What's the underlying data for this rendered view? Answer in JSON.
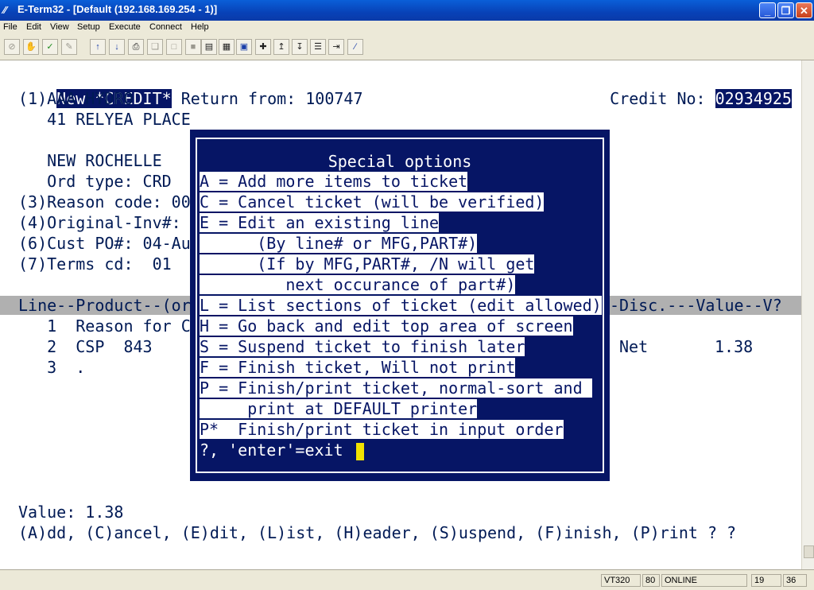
{
  "window": {
    "title": "E-Term32 - [Default (192.168.169.254 - 1)]"
  },
  "menu": [
    "File",
    "Edit",
    "View",
    "Setup",
    "Execute",
    "Connect",
    "Help"
  ],
  "terminal": {
    "credit_hl": "New *CREDIT*",
    "return_from": " Return from: 100747",
    "credit_no_label": "Credit No: ",
    "credit_no": "02934925",
    "customer": "(1)AAA HYDRO",
    "address1": "   41 RELYEA PLACE",
    "city": "   NEW ROCHELLE",
    "ord_type": "   Ord type: CRD",
    "reason_code": "(3)Reason code: 00",
    "orig_inv": "(4)Original-Inv#: ",
    "cust_po": "(6)Cust PO#: 04-Au",
    "terms": "(7)Terms cd:  01",
    "col_header_left": "Line--Product--(or",
    "col_header_right": "-Disc.---Value--V?",
    "line1": "   1  Reason for C",
    "line2": "   2  CSP  843",
    "line2_disc": "Net",
    "line2_value": "1.38",
    "line3": "   3  .",
    "value": "Value: 1.38",
    "command_prompt": "(A)dd, (C)ancel, (E)dit, (L)ist, (H)eader, (S)uspend, (F)inish, (P)rint ? ?"
  },
  "dialog": {
    "title": "Special options",
    "lines": [
      "A = Add more items to ticket",
      "C = Cancel ticket (will be verified)",
      "E = Edit an existing line",
      "      (By line# or MFG,PART#)",
      "      (If by MFG,PART#, /N will get",
      "         next occurance of part#)",
      "L = List sections of ticket (edit allowed)",
      "H = Go back and edit top area of screen",
      "S = Suspend ticket to finish later",
      "F = Finish ticket, Will not print",
      "P = Finish/print ticket, normal-sort and ",
      "     print at DEFAULT printer",
      "P*  Finish/print ticket in input order"
    ],
    "prompt": "?, 'enter'=exit "
  },
  "status": {
    "emulation": "VT320",
    "cols": "80",
    "state": "ONLINE",
    "row": "19",
    "col": "36"
  },
  "colors": {
    "terminal_bg": "#ffffff",
    "text": "#001a55",
    "dialog_bg": "#061565",
    "cursor": "#f2e200"
  }
}
